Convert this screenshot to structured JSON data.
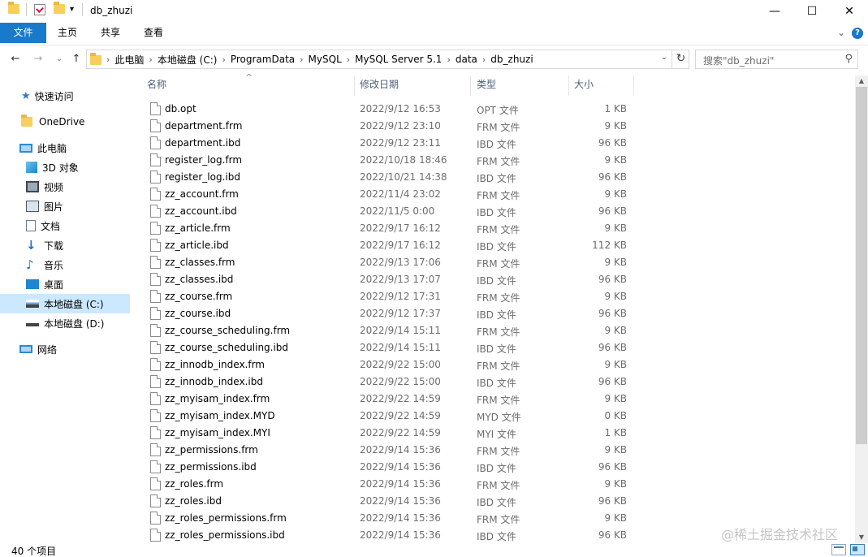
{
  "window": {
    "title": "db_zhuzi",
    "qa_more": "▾",
    "minimize": "—",
    "maximize": "☐",
    "close": "✕"
  },
  "ribbon": {
    "tabs": [
      "文件",
      "主页",
      "共享",
      "查看"
    ],
    "collapse": "⌄",
    "help": "?"
  },
  "nav": {
    "back": "←",
    "forward": "→",
    "recent": "⌄",
    "up": "↑",
    "refresh": "↻",
    "dropdown": "⌄",
    "breadcrumb": [
      "此电脑",
      "本地磁盘 (C:)",
      "ProgramData",
      "MySQL",
      "MySQL Server 5.1",
      "data",
      "db_zhuzi"
    ],
    "search_placeholder": "搜索\"db_zhuzi\"",
    "search_icon": "search-icon"
  },
  "sidebar": {
    "items": [
      {
        "label": "快速访问",
        "icon": "star-icon"
      },
      {
        "label": "OneDrive",
        "icon": "onedrive-folder-icon"
      },
      {
        "label": "此电脑",
        "icon": "computer-icon"
      },
      {
        "label": "3D 对象",
        "icon": "3d-objects-icon"
      },
      {
        "label": "视频",
        "icon": "video-icon"
      },
      {
        "label": "图片",
        "icon": "pictures-icon"
      },
      {
        "label": "文档",
        "icon": "documents-icon"
      },
      {
        "label": "下载",
        "icon": "download-icon"
      },
      {
        "label": "音乐",
        "icon": "music-icon"
      },
      {
        "label": "桌面",
        "icon": "desktop-icon"
      },
      {
        "label": "本地磁盘 (C:)",
        "icon": "local-disk-icon",
        "selected": true
      },
      {
        "label": "本地磁盘 (D:)",
        "icon": "disk-icon"
      },
      {
        "label": "网络",
        "icon": "network-icon"
      }
    ]
  },
  "columns": {
    "name": "名称",
    "date": "修改日期",
    "type": "类型",
    "size": "大小",
    "sort_indicator": "^"
  },
  "files": [
    {
      "name": "db.opt",
      "date": "2022/9/12 16:53",
      "type": "OPT 文件",
      "size": "1 KB"
    },
    {
      "name": "department.frm",
      "date": "2022/9/12 23:10",
      "type": "FRM 文件",
      "size": "9 KB"
    },
    {
      "name": "department.ibd",
      "date": "2022/9/12 23:11",
      "type": "IBD 文件",
      "size": "96 KB"
    },
    {
      "name": "register_log.frm",
      "date": "2022/10/18 18:46",
      "type": "FRM 文件",
      "size": "9 KB"
    },
    {
      "name": "register_log.ibd",
      "date": "2022/10/21 14:38",
      "type": "IBD 文件",
      "size": "96 KB"
    },
    {
      "name": "zz_account.frm",
      "date": "2022/11/4 23:02",
      "type": "FRM 文件",
      "size": "9 KB"
    },
    {
      "name": "zz_account.ibd",
      "date": "2022/11/5 0:00",
      "type": "IBD 文件",
      "size": "96 KB"
    },
    {
      "name": "zz_article.frm",
      "date": "2022/9/17 16:12",
      "type": "FRM 文件",
      "size": "9 KB"
    },
    {
      "name": "zz_article.ibd",
      "date": "2022/9/17 16:12",
      "type": "IBD 文件",
      "size": "112 KB"
    },
    {
      "name": "zz_classes.frm",
      "date": "2022/9/13 17:06",
      "type": "FRM 文件",
      "size": "9 KB"
    },
    {
      "name": "zz_classes.ibd",
      "date": "2022/9/13 17:07",
      "type": "IBD 文件",
      "size": "96 KB"
    },
    {
      "name": "zz_course.frm",
      "date": "2022/9/12 17:31",
      "type": "FRM 文件",
      "size": "9 KB"
    },
    {
      "name": "zz_course.ibd",
      "date": "2022/9/12 17:37",
      "type": "IBD 文件",
      "size": "96 KB"
    },
    {
      "name": "zz_course_scheduling.frm",
      "date": "2022/9/14 15:11",
      "type": "FRM 文件",
      "size": "9 KB"
    },
    {
      "name": "zz_course_scheduling.ibd",
      "date": "2022/9/14 15:11",
      "type": "IBD 文件",
      "size": "96 KB"
    },
    {
      "name": "zz_innodb_index.frm",
      "date": "2022/9/22 15:00",
      "type": "FRM 文件",
      "size": "9 KB"
    },
    {
      "name": "zz_innodb_index.ibd",
      "date": "2022/9/22 15:00",
      "type": "IBD 文件",
      "size": "96 KB"
    },
    {
      "name": "zz_myisam_index.frm",
      "date": "2022/9/22 14:59",
      "type": "FRM 文件",
      "size": "9 KB"
    },
    {
      "name": "zz_myisam_index.MYD",
      "date": "2022/9/22 14:59",
      "type": "MYD 文件",
      "size": "0 KB"
    },
    {
      "name": "zz_myisam_index.MYI",
      "date": "2022/9/22 14:59",
      "type": "MYI 文件",
      "size": "1 KB"
    },
    {
      "name": "zz_permissions.frm",
      "date": "2022/9/14 15:36",
      "type": "FRM 文件",
      "size": "9 KB"
    },
    {
      "name": "zz_permissions.ibd",
      "date": "2022/9/14 15:36",
      "type": "IBD 文件",
      "size": "96 KB"
    },
    {
      "name": "zz_roles.frm",
      "date": "2022/9/14 15:36",
      "type": "FRM 文件",
      "size": "9 KB"
    },
    {
      "name": "zz_roles.ibd",
      "date": "2022/9/14 15:36",
      "type": "IBD 文件",
      "size": "96 KB"
    },
    {
      "name": "zz_roles_permissions.frm",
      "date": "2022/9/14 15:36",
      "type": "FRM 文件",
      "size": "9 KB"
    },
    {
      "name": "zz_roles_permissions.ibd",
      "date": "2022/9/14 15:36",
      "type": "IBD 文件",
      "size": "96 KB"
    }
  ],
  "scrollbar": {
    "up": "▲",
    "down": "▼"
  },
  "status": {
    "count": "40 个项目"
  },
  "watermark": "@稀土掘金技术社区",
  "colors": {
    "file_tab": "#1979ca",
    "selection": "#cce8ff",
    "header_text": "#4c607a"
  }
}
